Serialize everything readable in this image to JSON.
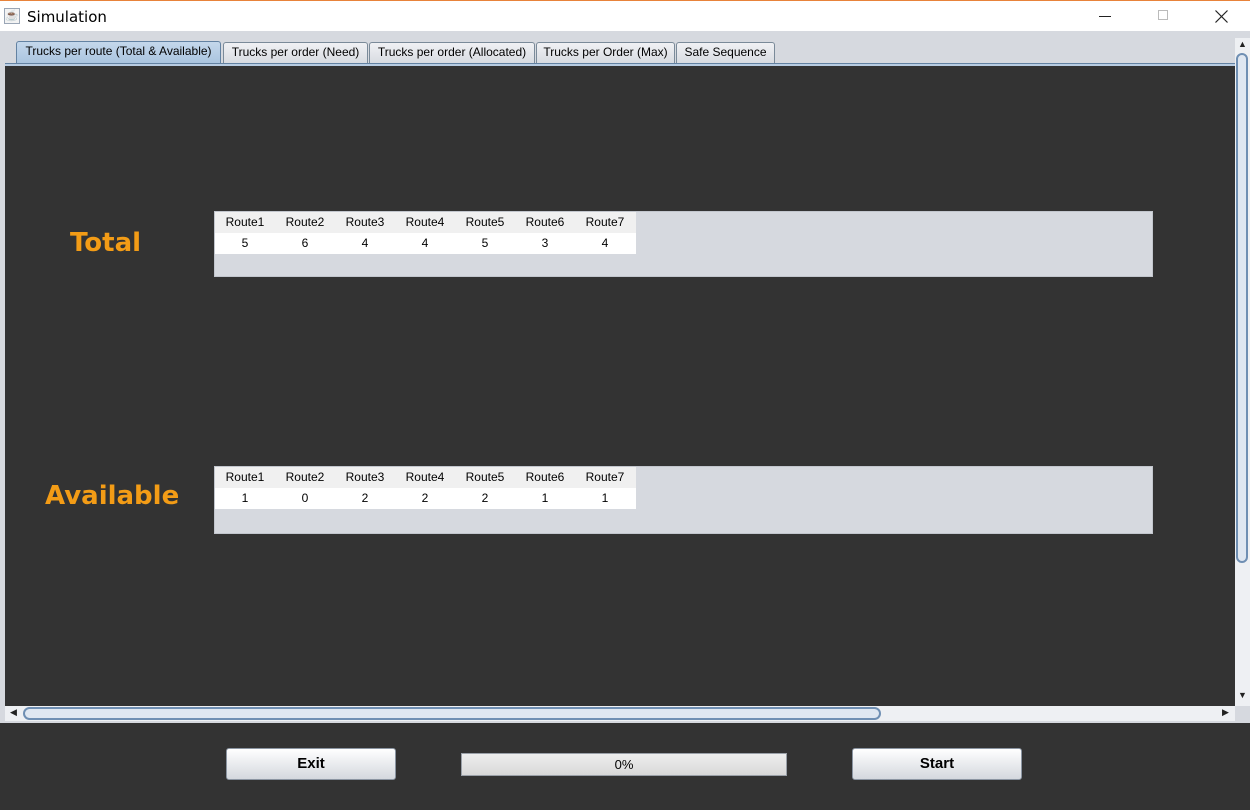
{
  "window": {
    "title": "Simulation",
    "app_icon": "java-cup-icon",
    "title_bar_accent": "#e8833a"
  },
  "tabs": [
    {
      "label": "Trucks per route (Total & Available)",
      "active": true
    },
    {
      "label": "Trucks per order (Need)",
      "active": false
    },
    {
      "label": "Trucks per order (Allocated)",
      "active": false
    },
    {
      "label": "Trucks per Order (Max)",
      "active": false
    },
    {
      "label": "Safe Sequence",
      "active": false
    }
  ],
  "total": {
    "label": "Total",
    "headers": [
      "Route1",
      "Route2",
      "Route3",
      "Route4",
      "Route5",
      "Route6",
      "Route7"
    ],
    "values": [
      "5",
      "6",
      "4",
      "4",
      "5",
      "3",
      "4"
    ]
  },
  "available": {
    "label": "Available",
    "headers": [
      "Route1",
      "Route2",
      "Route3",
      "Route4",
      "Route5",
      "Route6",
      "Route7"
    ],
    "values": [
      "1",
      "0",
      "2",
      "2",
      "2",
      "1",
      "1"
    ]
  },
  "controls": {
    "exit_label": "Exit",
    "start_label": "Start",
    "progress_text": "0%",
    "progress_value": 0
  },
  "colors": {
    "background": "#333333",
    "label_orange": "#f39c16",
    "panel": "#d6d9df"
  }
}
